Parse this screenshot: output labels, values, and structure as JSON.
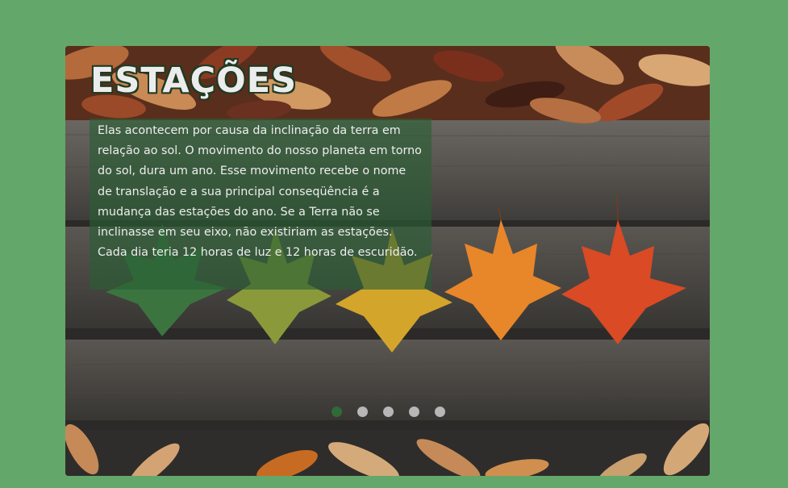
{
  "slider": {
    "title": "ESTAÇÕES",
    "description": "Elas acontecem por causa da inclinação da terra em relação ao sol. O movimento do nosso planeta em torno do sol, dura um ano. Esse movimento recebe o nome de translação e a sua principal conseqüência é a mudança das estações do ano. Se a Terra não se inclinasse em seu eixo, não existiriam as estações. Cada dia teria 12 horas de luz e 12 horas de escuridão.",
    "slide_count": 5,
    "active_slide": 1
  },
  "colors": {
    "page_background": "#64a76a",
    "active_dot": "#2e6b39",
    "inactive_dot": "#b7b7b7",
    "overlay": "#286034"
  }
}
